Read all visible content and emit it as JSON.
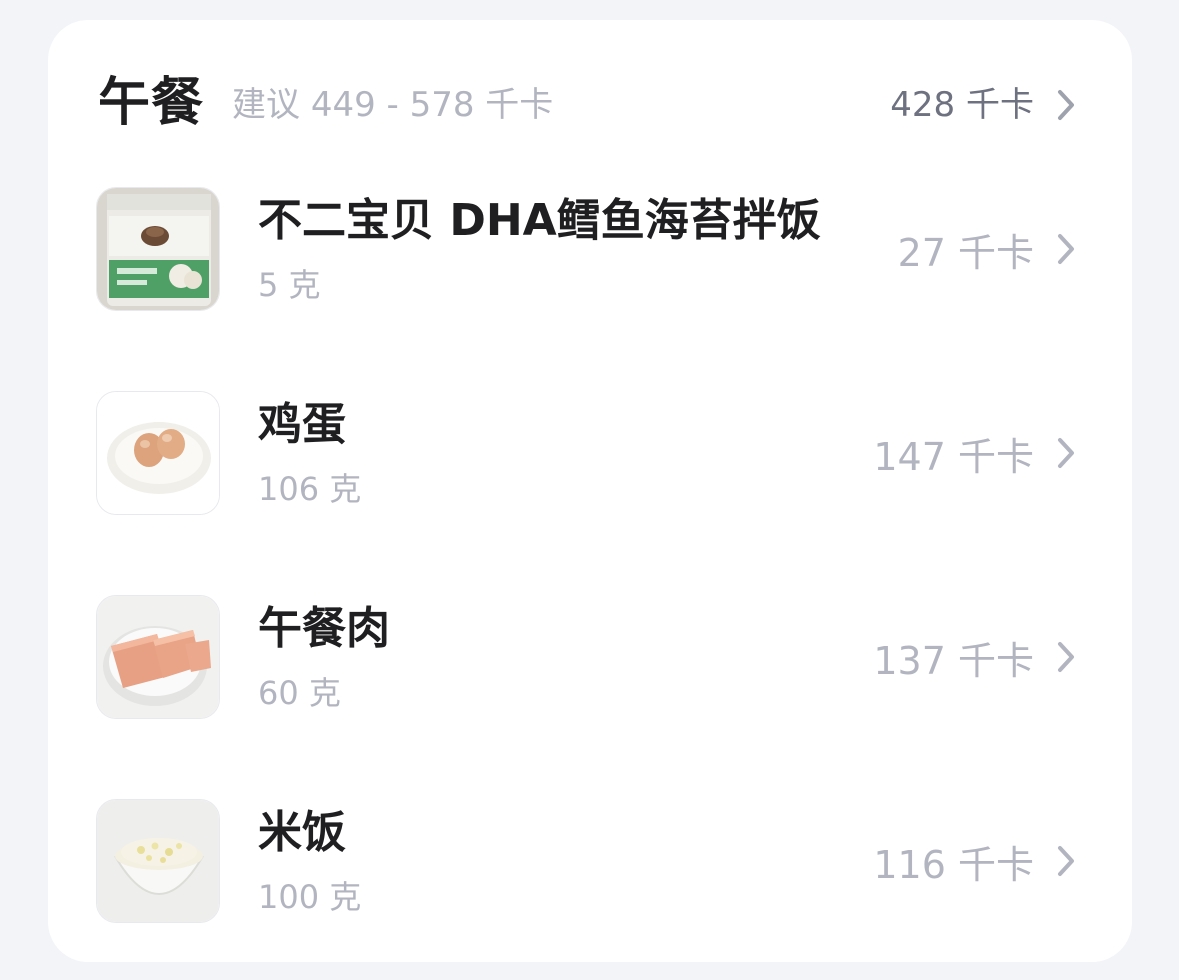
{
  "meal": {
    "title": "午餐",
    "suggestion": "建议 449 - 578 千卡",
    "total": "428 千卡"
  },
  "items": [
    {
      "name": "不二宝贝 DHA鳕鱼海苔拌饭",
      "weight": "5 克",
      "kcal": "27 千卡",
      "thumb": "seaweed-rice-package"
    },
    {
      "name": "鸡蛋",
      "weight": "106 克",
      "kcal": "147 千卡",
      "thumb": "eggs-plate"
    },
    {
      "name": "午餐肉",
      "weight": "60 克",
      "kcal": "137 千卡",
      "thumb": "luncheon-meat-plate"
    },
    {
      "name": "米饭",
      "weight": "100 克",
      "kcal": "116 千卡",
      "thumb": "rice-bowl"
    }
  ],
  "icons": {
    "chevron": "chevron-right-icon"
  },
  "colors": {
    "background": "#f3f4f8",
    "card": "#ffffff",
    "title": "#1f1f22",
    "muted": "#b2b5c0",
    "total": "#6d7180"
  }
}
